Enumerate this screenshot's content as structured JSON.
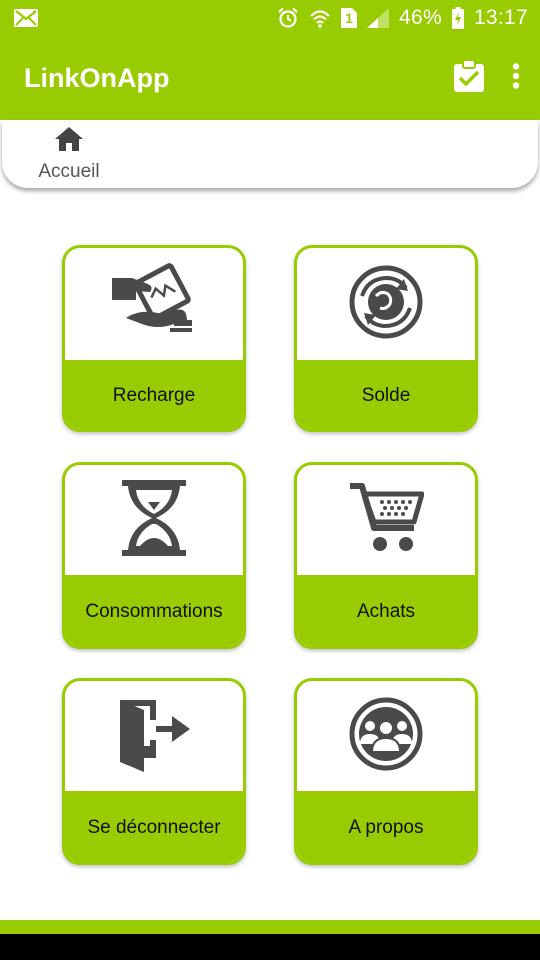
{
  "status_bar": {
    "battery_text": "46%",
    "time": "13:17",
    "sim_slot": "1",
    "icons": [
      "email-icon",
      "alarm-icon",
      "wifi-icon",
      "sim-icon",
      "signal-icon",
      "battery-charging-icon"
    ]
  },
  "app_bar": {
    "title": "LinkOnApp",
    "actions": [
      "clipboard-check-icon",
      "more-vert-icon"
    ]
  },
  "breadcrumb": {
    "home_label": "Accueil",
    "icon": "home-icon"
  },
  "tiles": [
    {
      "label": "Recharge",
      "icon": "recharge-hand-card-icon"
    },
    {
      "label": "Solde",
      "icon": "globe-refresh-icon"
    },
    {
      "label": "Consommations",
      "icon": "hourglass-icon"
    },
    {
      "label": "Achats",
      "icon": "shopping-cart-icon"
    },
    {
      "label": "Se déconnecter",
      "icon": "logout-door-icon"
    },
    {
      "label": "A propos",
      "icon": "group-icon"
    }
  ],
  "colors": {
    "accent": "#99cc00",
    "icon": "#4a4a4a",
    "text": "#111111",
    "label_grey": "#555555"
  }
}
